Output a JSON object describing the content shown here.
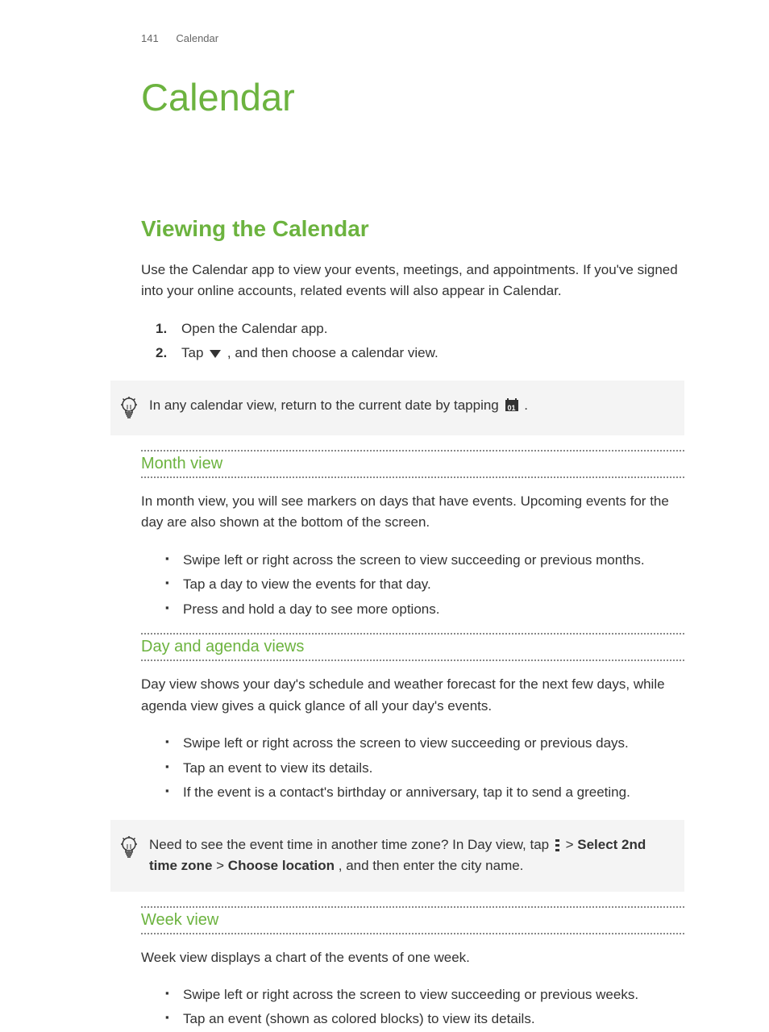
{
  "header": {
    "page_number": "141",
    "section_name": "Calendar"
  },
  "chapter": {
    "title": "Calendar"
  },
  "section": {
    "title": "Viewing the Calendar",
    "intro": "Use the Calendar app to view your events, meetings, and appointments. If you've signed into your online accounts, related events will also appear in Calendar.",
    "steps": [
      "Open the Calendar app.",
      {
        "prefix": "Tap ",
        "suffix": " , and then choose a calendar view.",
        "icon": "triangle-down"
      }
    ],
    "tip1": {
      "prefix": "In any calendar view, return to the current date by tapping ",
      "icon": "today-icon",
      "icon_label": "01",
      "suffix": " ."
    },
    "month_view": {
      "heading": "Month view",
      "paragraph": "In month view, you will see markers on days that have events. Upcoming events for the day are also shown at the bottom of the screen.",
      "bullets": [
        "Swipe left or right across the screen to view succeeding or previous months.",
        "Tap a day to view the events for that day.",
        "Press and hold a day to see more options."
      ]
    },
    "day_agenda": {
      "heading": "Day and agenda views",
      "paragraph": "Day view shows your day's schedule and weather forecast for the next few days, while agenda view gives a quick glance of all your day's events.",
      "bullets": [
        "Swipe left or right across the screen to view succeeding or previous days.",
        "Tap an event to view its details.",
        "If the event is a contact's birthday or anniversary, tap it to send a greeting."
      ]
    },
    "tip2": {
      "prefix": "Need to see the event time in another time zone? In Day view, tap ",
      "icon": "menu-icon",
      "mid1": " > ",
      "bold1": "Select 2nd time zone",
      "mid2": " > ",
      "bold2": "Choose location",
      "suffix": ", and then enter the city name."
    },
    "week_view": {
      "heading": "Week view",
      "paragraph": "Week view displays a chart of the events of one week.",
      "bullets": [
        "Swipe left or right across the screen to view succeeding or previous weeks.",
        "Tap an event (shown as colored blocks) to view its details."
      ]
    }
  }
}
